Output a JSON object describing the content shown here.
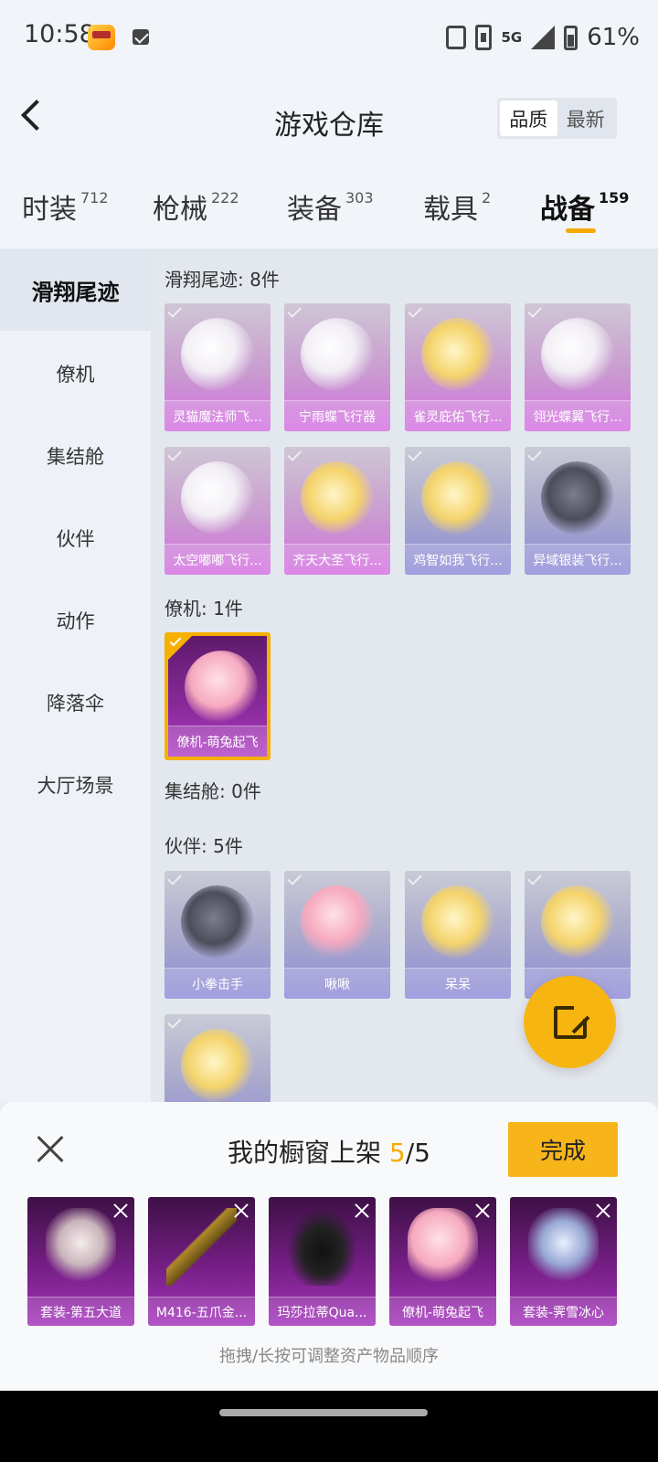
{
  "status_bar": {
    "time": "10:58",
    "network": "5G",
    "battery": "61%",
    "icons": [
      "app-notification-icon",
      "mail-icon",
      "vibrate-icon",
      "sim-icon",
      "signal-icon",
      "battery-icon"
    ]
  },
  "header": {
    "title": "游戏仓库",
    "sort_options": [
      "品质",
      "最新"
    ],
    "active_sort": "品质"
  },
  "categories": [
    {
      "label": "时装",
      "count": "712"
    },
    {
      "label": "枪械",
      "count": "222"
    },
    {
      "label": "装备",
      "count": "303"
    },
    {
      "label": "载具",
      "count": "2"
    },
    {
      "label": "战备",
      "count": "159"
    }
  ],
  "active_category": "战备",
  "sidebar": {
    "items": [
      "滑翔尾迹",
      "僚机",
      "集结舱",
      "伙伴",
      "动作",
      "降落伞",
      "大厅场景"
    ],
    "active": "滑翔尾迹"
  },
  "sections": [
    {
      "title": "滑翔尾迹: 8件",
      "items": [
        "灵猫魔法师飞...",
        "宁雨蝶飞行器",
        "雀灵庇佑飞行...",
        "翎光蝶翼飞行...",
        "太空嘟嘟飞行...",
        "齐天大圣飞行...",
        "鸡智如我飞行...",
        "异域银装飞行..."
      ]
    },
    {
      "title": "僚机: 1件",
      "items": [
        "僚机-萌兔起飞"
      ]
    },
    {
      "title": "集结舱: 0件",
      "items": []
    },
    {
      "title": "伙伴: 5件",
      "items": [
        "小拳击手",
        "啾啾",
        "呆呆",
        "",
        ""
      ]
    }
  ],
  "bottom_panel": {
    "title_prefix": "我的橱窗上架 ",
    "current": "5",
    "total": "/5",
    "done_label": "完成",
    "slots": [
      "套装-第五大道",
      "M416-五爪金...",
      "玛莎拉蒂Qua...",
      "僚机-萌兔起飞",
      "套装-霁雪冰心"
    ],
    "hint": "拖拽/长按可调整资产物品顺序"
  },
  "colors": {
    "accent": "#f5ab00",
    "button": "#f7b51a"
  }
}
